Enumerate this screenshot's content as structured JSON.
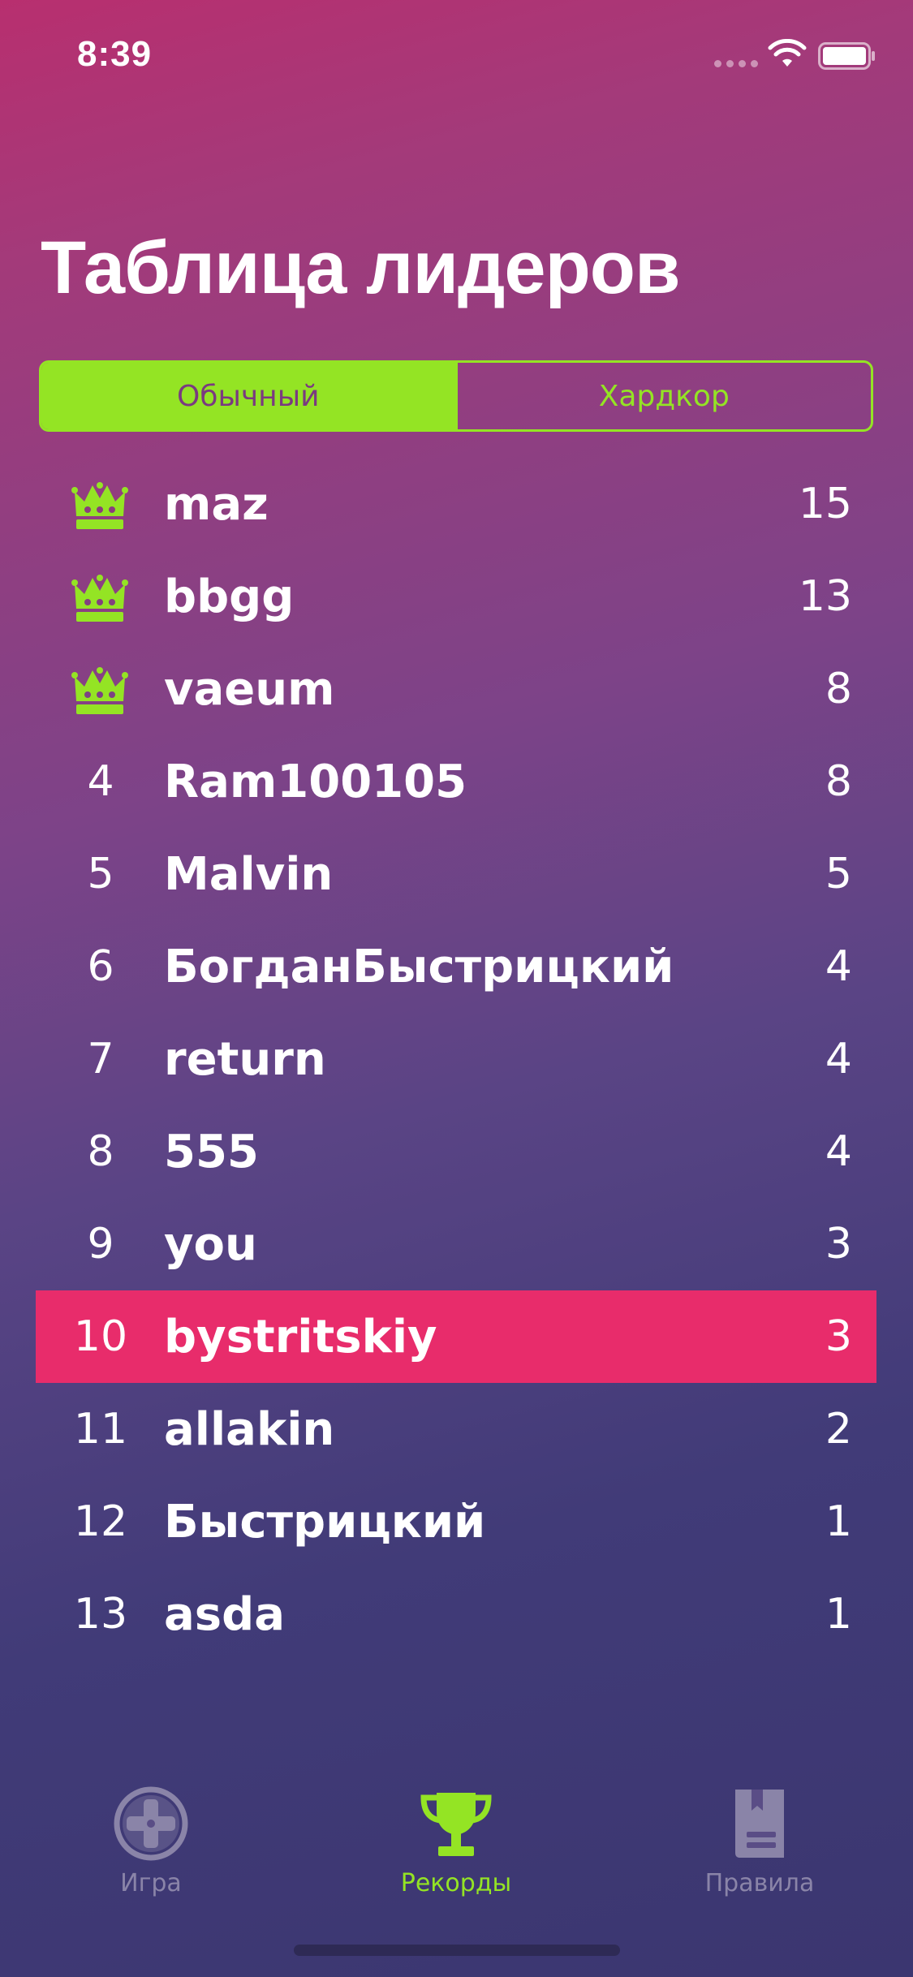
{
  "status_bar": {
    "time": "8:39"
  },
  "page": {
    "title": "Таблица лидеров"
  },
  "segments": {
    "normal": "Обычный",
    "hardcore": "Хардкор",
    "selected": "normal"
  },
  "leaderboard": [
    {
      "rank": "1",
      "name": "maz",
      "score": "15",
      "crown": true
    },
    {
      "rank": "2",
      "name": "bbgg",
      "score": "13",
      "crown": true
    },
    {
      "rank": "3",
      "name": "vaeum",
      "score": "8",
      "crown": true
    },
    {
      "rank": "4",
      "name": "Ram100105",
      "score": "8",
      "crown": false
    },
    {
      "rank": "5",
      "name": "Malvin",
      "score": "5",
      "crown": false
    },
    {
      "rank": "6",
      "name": "БогданБыстрицкий",
      "score": "4",
      "crown": false
    },
    {
      "rank": "7",
      "name": "return",
      "score": "4",
      "crown": false
    },
    {
      "rank": "8",
      "name": "555",
      "score": "4",
      "crown": false
    },
    {
      "rank": "9",
      "name": "you",
      "score": "3",
      "crown": false
    },
    {
      "rank": "10",
      "name": "bystritskiy",
      "score": "3",
      "crown": false,
      "highlighted": true
    },
    {
      "rank": "11",
      "name": "allakin",
      "score": "2",
      "crown": false
    },
    {
      "rank": "12",
      "name": "Быстрицкий",
      "score": "1",
      "crown": false
    },
    {
      "rank": "13",
      "name": "asda",
      "score": "1",
      "crown": false
    }
  ],
  "tab_bar": {
    "game": {
      "label": "Игра",
      "icon": "gamepad-icon"
    },
    "records": {
      "label": "Рекорды",
      "icon": "trophy-icon",
      "active": true
    },
    "rules": {
      "label": "Правила",
      "icon": "book-icon"
    }
  },
  "colors": {
    "accent": "#94e424",
    "highlight": "#e82c6b",
    "inactive_tab": "#8a84a8"
  }
}
